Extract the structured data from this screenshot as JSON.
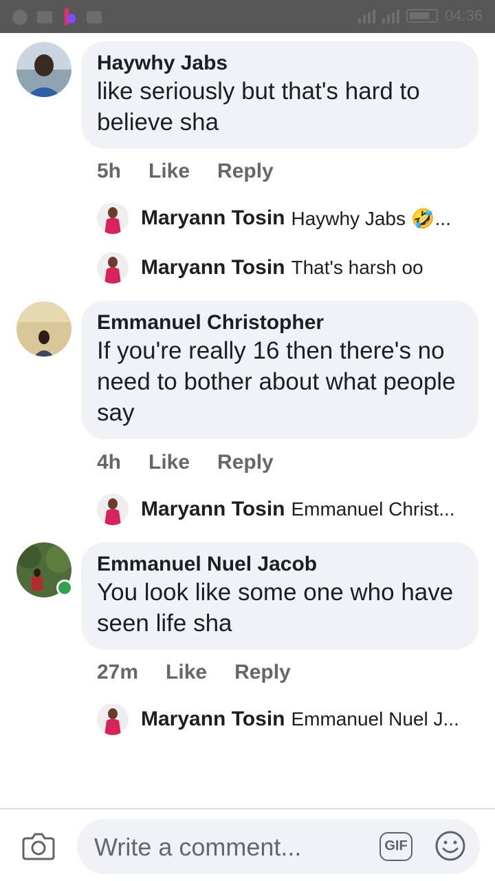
{
  "status_bar": {
    "time": "04:36"
  },
  "comments": [
    {
      "author": "Haywhy Jabs",
      "text": "like seriously but that's hard to believe sha",
      "time": "5h",
      "like_label": "Like",
      "reply_label": "Reply",
      "replies": [
        {
          "author": "Maryann Tosin",
          "text": "Haywhy Jabs 🤣..."
        },
        {
          "author": "Maryann Tosin",
          "text": "That's harsh oo"
        }
      ]
    },
    {
      "author": "Emmanuel Christopher",
      "text": "If you're really 16 then there's no need to bother about what people say",
      "time": "4h",
      "like_label": "Like",
      "reply_label": "Reply",
      "replies": [
        {
          "author": "Maryann Tosin",
          "text": "Emmanuel Christ..."
        }
      ]
    },
    {
      "author": "Emmanuel Nuel Jacob",
      "text": "You look like some one who have seen life sha",
      "time": "27m",
      "like_label": "Like",
      "reply_label": "Reply",
      "online": true,
      "replies": [
        {
          "author": "Maryann Tosin",
          "text": "Emmanuel Nuel J..."
        }
      ]
    }
  ],
  "composer": {
    "placeholder": "Write a comment...",
    "gif_label": "GIF",
    "icons": [
      "camera-icon",
      "gif-icon",
      "emoji-icon"
    ]
  },
  "colors": {
    "bubble": "#f0f2f5",
    "meta": "#65676b",
    "online": "#31a24c"
  }
}
